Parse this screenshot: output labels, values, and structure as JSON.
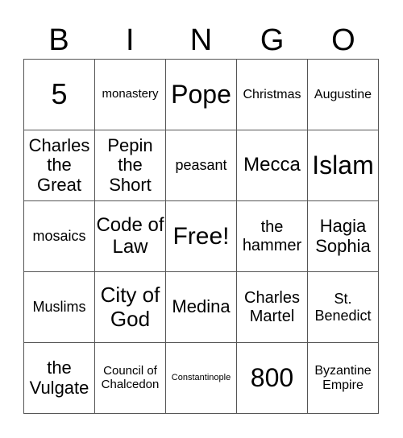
{
  "header": [
    "B",
    "I",
    "N",
    "G",
    "O"
  ],
  "cells": [
    [
      "5",
      "monastery",
      "Pope",
      "Christmas",
      "Augustine"
    ],
    [
      "Charles the Great",
      "Pepin the Short",
      "peasant",
      "Mecca",
      "Islam"
    ],
    [
      "mosaics",
      "Code of Law",
      "Free!",
      "the hammer",
      "Hagia Sophia"
    ],
    [
      "Muslims",
      "City of God",
      "Medina",
      "Charles Martel",
      "St. Benedict"
    ],
    [
      "the Vulgate",
      "Council of Chalcedon",
      "Constantinople",
      "800",
      "Byzantine Empire"
    ]
  ]
}
